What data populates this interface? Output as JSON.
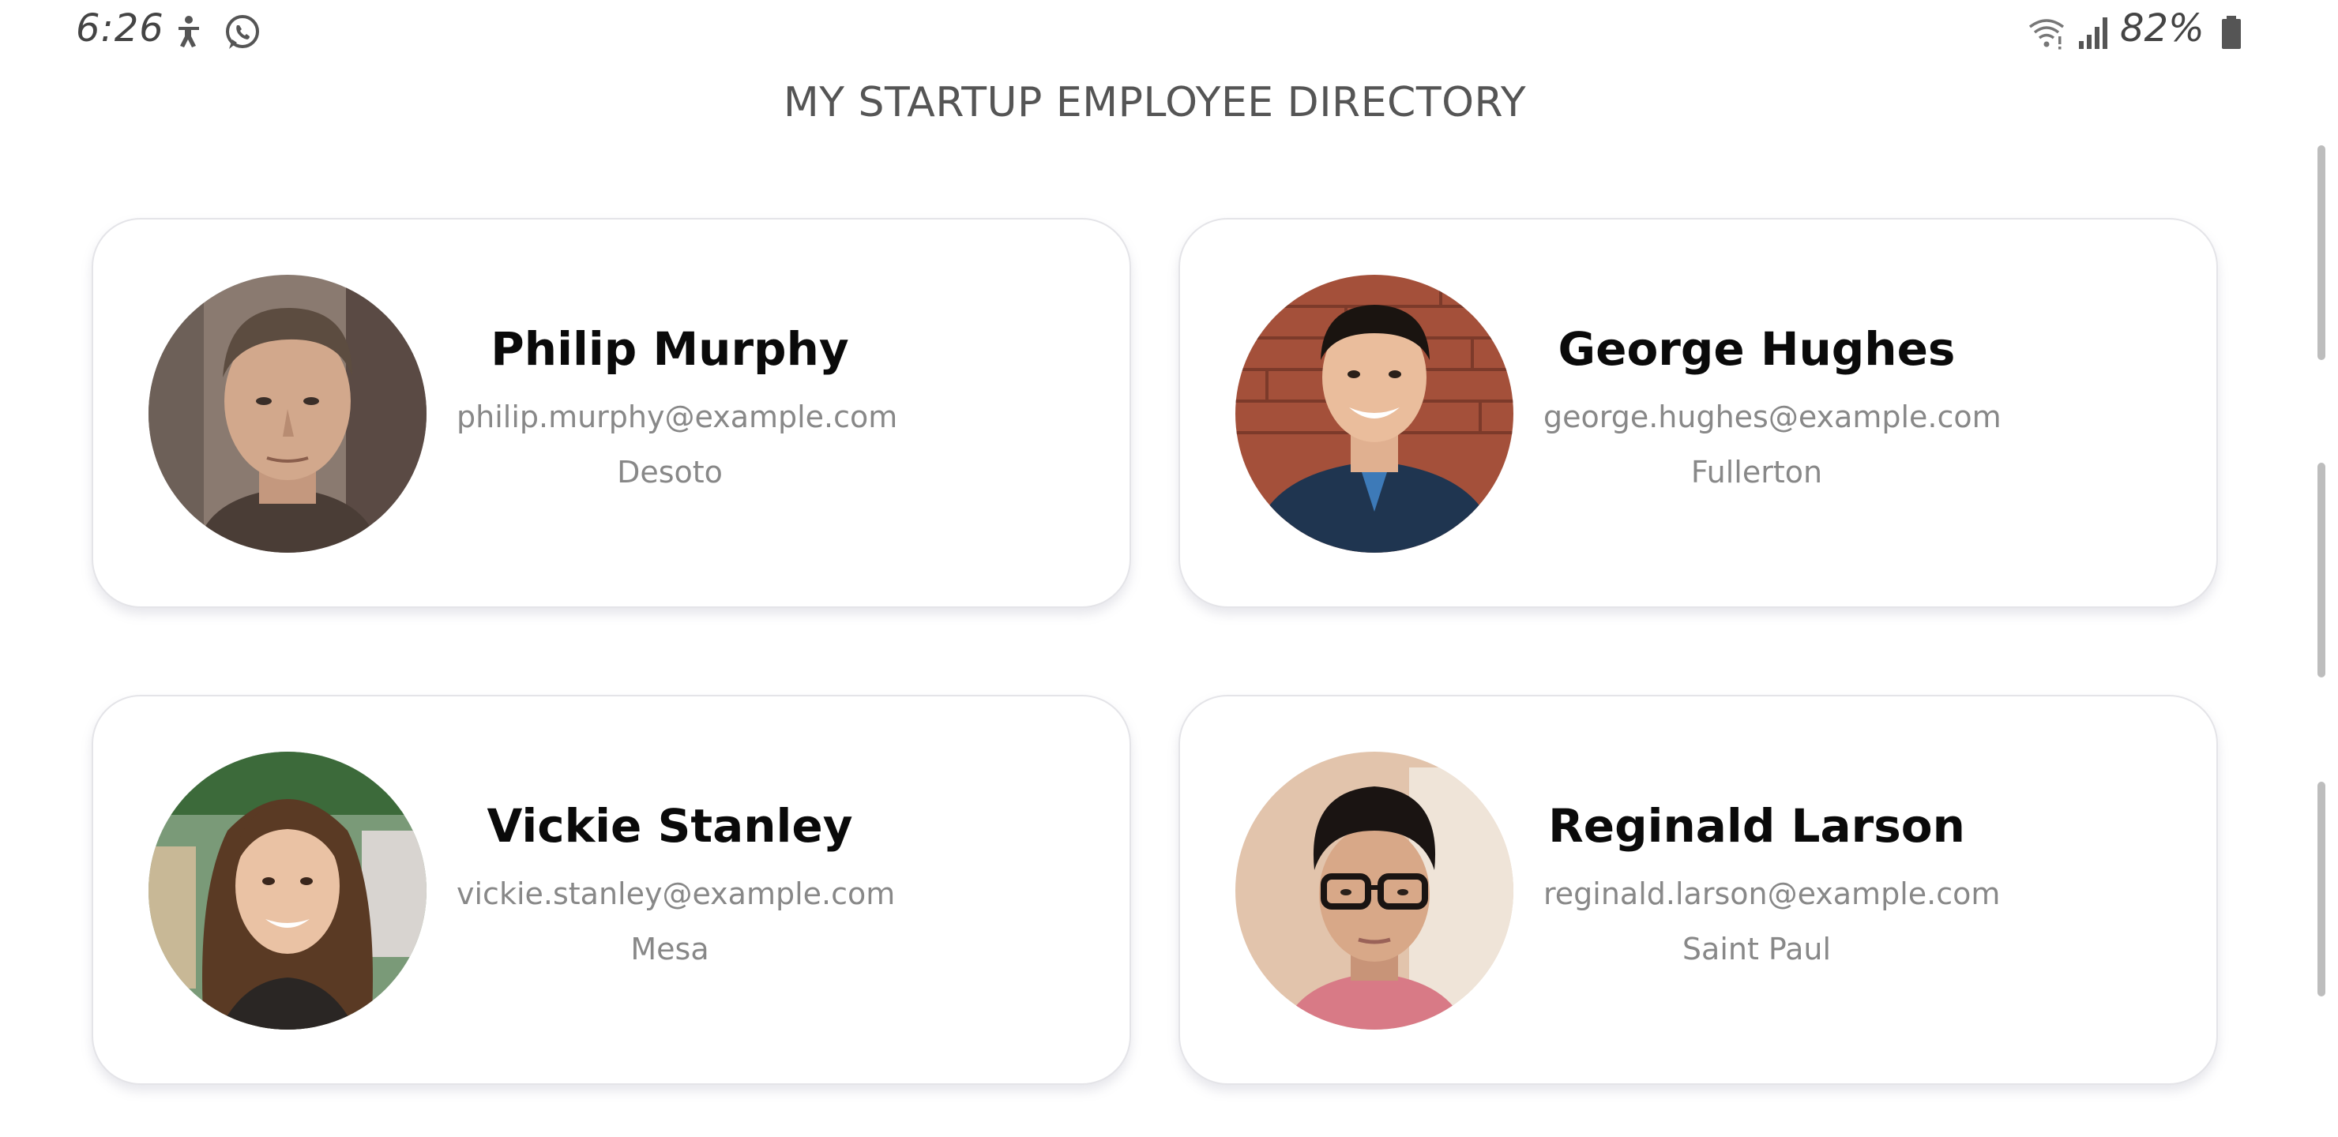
{
  "status_bar": {
    "time": "6:26",
    "battery": "82%",
    "icons": [
      "accessibility-icon",
      "whatsapp-icon",
      "wifi-icon",
      "signal-icon",
      "battery-icon"
    ]
  },
  "title": "MY STARTUP EMPLOYEE DIRECTORY",
  "employees": [
    {
      "name": "Philip Murphy",
      "email": "philip.murphy@example.com",
      "city": "Desoto"
    },
    {
      "name": "George Hughes",
      "email": "george.hughes@example.com",
      "city": "Fullerton"
    },
    {
      "name": "Vickie Stanley",
      "email": "vickie.stanley@example.com",
      "city": "Mesa"
    },
    {
      "name": "Reginald Larson",
      "email": "reginald.larson@example.com",
      "city": "Saint Paul"
    }
  ],
  "colors": {
    "card_border": "#e4e4e8",
    "name_text": "#0a0a0a",
    "secondary_text": "#888888",
    "title_text": "#555555"
  }
}
